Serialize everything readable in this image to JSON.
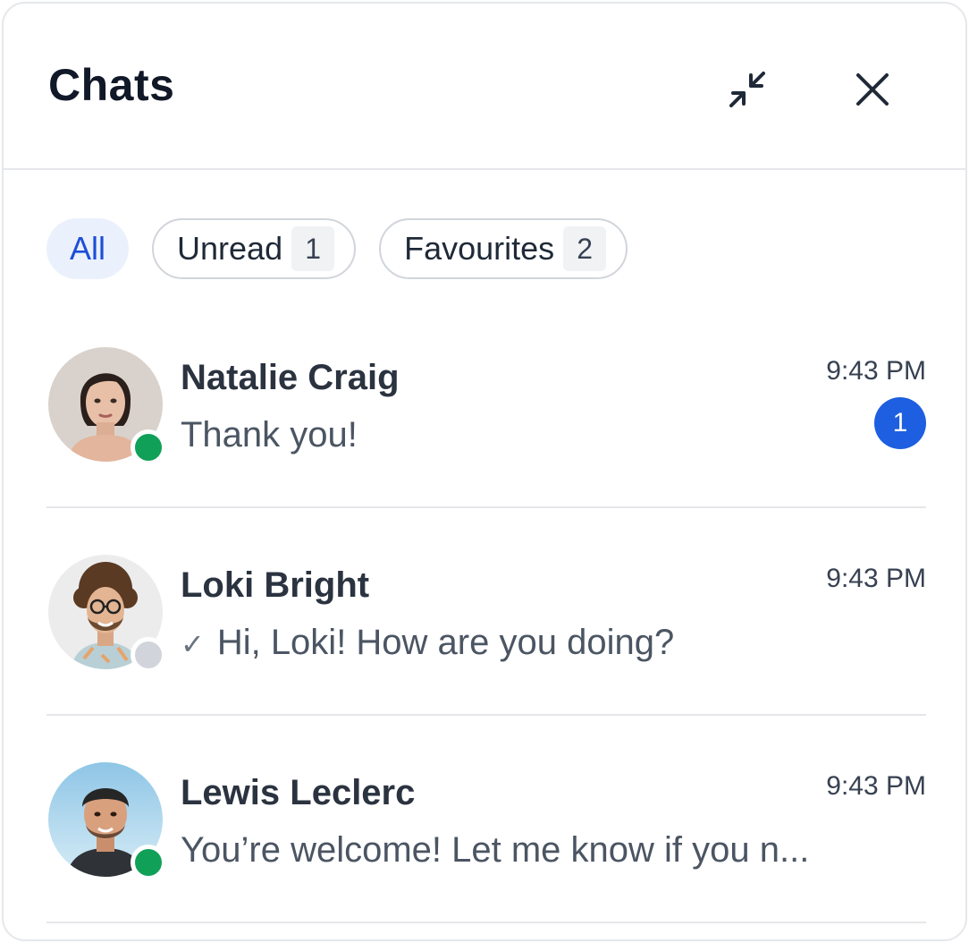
{
  "header": {
    "title": "Chats"
  },
  "filters": {
    "all_label": "All",
    "unread_label": "Unread",
    "unread_count": "1",
    "favourites_label": "Favourites",
    "favourites_count": "2"
  },
  "colors": {
    "accent": "#1d5fe0",
    "online": "#10a058",
    "offline": "#d1d5db"
  },
  "chats": [
    {
      "name": "Natalie Craig",
      "preview": "Thank you!",
      "time": "9:43 PM",
      "unread": "1",
      "status": "online",
      "sent_check": false
    },
    {
      "name": "Loki Bright",
      "preview": "Hi, Loki! How are you doing?",
      "time": "9:43 PM",
      "unread": null,
      "status": "offline",
      "sent_check": true,
      "check_icon": "✓"
    },
    {
      "name": "Lewis Leclerc",
      "preview": "You’re welcome! Let me know if you n...",
      "time": "9:43 PM",
      "unread": null,
      "status": "online",
      "sent_check": false
    }
  ]
}
